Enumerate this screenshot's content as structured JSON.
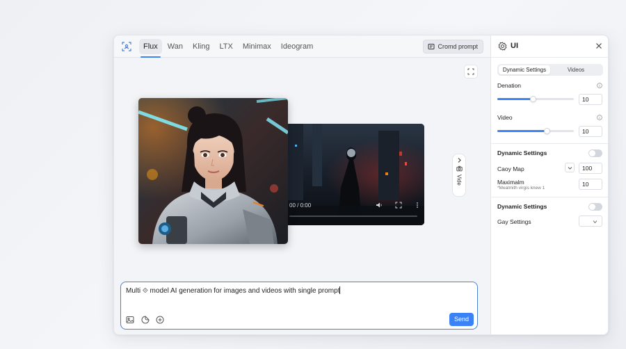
{
  "tabs": [
    "Flux",
    "Wan",
    "Kling",
    "LTX",
    "Minimax",
    "Ideogram"
  ],
  "active_tab": "Flux",
  "prompt_button": "Cromd prompt",
  "video": {
    "time": "00 / 0:00"
  },
  "side_pill": {
    "label": "Vide"
  },
  "composer": {
    "text": "Multi ⟐ model AI generation for images and videos with single prompt",
    "send": "Send"
  },
  "panel": {
    "title": "UI",
    "segments": [
      "Dynamic Settings",
      "Videos"
    ],
    "denation": {
      "label": "Denation",
      "value": "10",
      "level": 0.47
    },
    "video": {
      "label": "Video",
      "value": "10",
      "level": 0.65
    },
    "section1": {
      "title": "Dynamic Settings",
      "caoy_label": "Caoy Map",
      "caoy_value": "100",
      "max_label": "Maximalm",
      "max_sub": "*Mealmith virgis knew 1",
      "max_value": "10"
    },
    "section2": {
      "title": "Dynamic Settings",
      "gay_label": "Gay Settings"
    }
  },
  "colors": {
    "accent": "#3b82f6",
    "panel_bg": "#ffffff",
    "main_bg": "#f3f4f7"
  }
}
